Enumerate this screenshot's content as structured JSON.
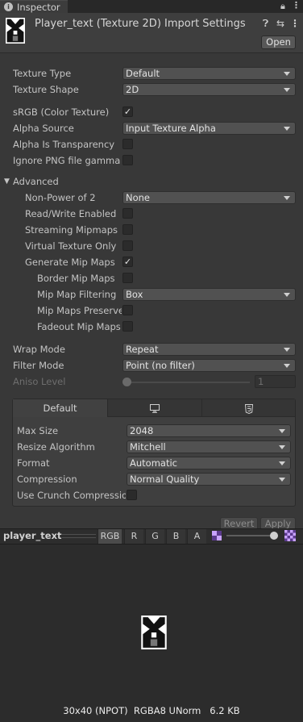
{
  "tab": {
    "label": "Inspector"
  },
  "header": {
    "title": "Player_text (Texture 2D) Import Settings",
    "open_label": "Open"
  },
  "general": {
    "texture_type": {
      "label": "Texture Type",
      "value": "Default"
    },
    "texture_shape": {
      "label": "Texture Shape",
      "value": "2D"
    },
    "srgb": {
      "label": "sRGB (Color Texture)",
      "checked": true
    },
    "alpha_source": {
      "label": "Alpha Source",
      "value": "Input Texture Alpha"
    },
    "alpha_is_transparency": {
      "label": "Alpha Is Transparency",
      "checked": false
    },
    "ignore_png_gamma": {
      "label": "Ignore PNG file gamma",
      "checked": false
    }
  },
  "advanced": {
    "label": "Advanced",
    "npot": {
      "label": "Non-Power of 2",
      "value": "None"
    },
    "read_write": {
      "label": "Read/Write Enabled",
      "checked": false
    },
    "streaming_mipmaps": {
      "label": "Streaming Mipmaps",
      "checked": false
    },
    "virtual_texture_only": {
      "label": "Virtual Texture Only",
      "checked": false
    },
    "generate_mip_maps": {
      "label": "Generate Mip Maps",
      "checked": true
    },
    "border_mip_maps": {
      "label": "Border Mip Maps",
      "checked": false
    },
    "mip_map_filtering": {
      "label": "Mip Map Filtering",
      "value": "Box"
    },
    "mip_maps_preserve": {
      "label": "Mip Maps Preserve",
      "checked": false
    },
    "fadeout_mip_maps": {
      "label": "Fadeout Mip Maps",
      "checked": false
    }
  },
  "sampling": {
    "wrap_mode": {
      "label": "Wrap Mode",
      "value": "Repeat"
    },
    "filter_mode": {
      "label": "Filter Mode",
      "value": "Point (no filter)"
    },
    "aniso_level": {
      "label": "Aniso Level",
      "value": "1",
      "level": 0.0
    }
  },
  "platform": {
    "tabs": [
      "Default"
    ],
    "max_size": {
      "label": "Max Size",
      "value": "2048"
    },
    "resize_algorithm": {
      "label": "Resize Algorithm",
      "value": "Mitchell"
    },
    "format": {
      "label": "Format",
      "value": "Automatic"
    },
    "compression": {
      "label": "Compression",
      "value": "Normal Quality"
    },
    "use_crunch": {
      "label": "Use Crunch Compressio",
      "checked": false
    }
  },
  "buttons": {
    "revert": "Revert",
    "apply": "Apply"
  },
  "preview": {
    "title": "player_text",
    "channels": [
      "RGB",
      "R",
      "G",
      "B",
      "A"
    ],
    "mip_level": 1.0,
    "info": "30x40 (NPOT)  RGBA8 UNorm   6.2 KB"
  }
}
